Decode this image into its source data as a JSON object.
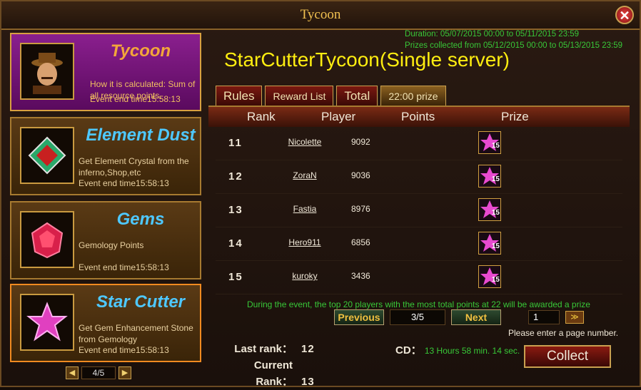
{
  "window": {
    "title": "Tycoon",
    "close_label": "✕"
  },
  "sidebar": {
    "cards": [
      {
        "title": "Tycoon",
        "desc": "How it is calculated: Sum of all resource points.",
        "end": "Event end time15:58:13"
      },
      {
        "title": "Element Dust",
        "desc": "Get Element Crystal from the inferno,Shop,etc",
        "end": "Event end time15:58:13"
      },
      {
        "title": "Gems",
        "desc": "Gemology Points",
        "end": "Event end time15:58:13"
      },
      {
        "title": "Star Cutter",
        "desc": "Get Gem Enhancement Stone from Gemology",
        "end": "Event end time15:58:13"
      }
    ],
    "pager": {
      "label": "4/5",
      "prev": "◀",
      "next": "▶"
    }
  },
  "main": {
    "duration": "Duration: 05/07/2015 00:00 to 05/11/2015 23:59",
    "prizes_collected": "Prizes collected from 05/12/2015 00:00 to 05/13/2015 23:59",
    "headline": "StarCutterTycoon(Single server)",
    "tabs": [
      "Rules",
      "Reward List",
      "Total",
      "22:00 prize"
    ],
    "table": {
      "headers": [
        "Rank",
        "Player",
        "Points",
        "Prize"
      ],
      "rows": [
        {
          "rank": "11",
          "player": "Nicolette",
          "points": "9092",
          "prize_count": "15"
        },
        {
          "rank": "12",
          "player": "ZoraN",
          "points": "9036",
          "prize_count": "15"
        },
        {
          "rank": "13",
          "player": "Fastia",
          "points": "8976",
          "prize_count": "15"
        },
        {
          "rank": "14",
          "player": "Hero911",
          "points": "6856",
          "prize_count": "15"
        },
        {
          "rank": "15",
          "player": "kuroky",
          "points": "3436",
          "prize_count": "15"
        }
      ]
    },
    "notice": "During the event, the top 20 players with the most total points at 22 will be awarded a prize",
    "pager": {
      "previous": "Previous",
      "page": "3/5",
      "next": "Next",
      "input_value": "1",
      "go": "≫"
    },
    "hint": "Please enter a page number.",
    "last_rank_label": "Last rank：",
    "last_rank": "12",
    "current_rank_label": "Current Rank：",
    "current_rank": "13",
    "cd_label": "CD：",
    "cd_value": "13 Hours 58 min. 14 sec.",
    "collect_label": "Collect"
  },
  "colors": {
    "accent_gold": "#f0c050",
    "green_text": "#38c838",
    "headline_yellow": "#ffee10",
    "skill_blue": "#4ec8ff"
  }
}
